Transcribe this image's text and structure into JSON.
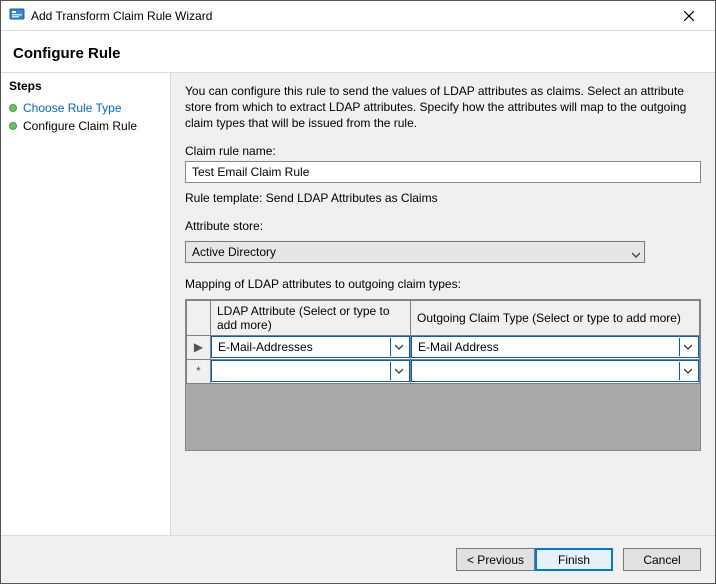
{
  "window": {
    "title": "Add Transform Claim Rule Wizard"
  },
  "header": {
    "title": "Configure Rule"
  },
  "steps": {
    "title": "Steps",
    "items": [
      {
        "label": "Choose Rule Type",
        "link": true
      },
      {
        "label": "Configure Claim Rule",
        "link": false
      }
    ]
  },
  "description": "You can configure this rule to send the values of LDAP attributes as claims. Select an attribute store from which to extract LDAP attributes. Specify how the attributes will map to the outgoing claim types that will be issued from the rule.",
  "form": {
    "claimRuleNameLabel": "Claim rule name:",
    "claimRuleName": "Test Email Claim Rule",
    "ruleTemplatePrefix": "Rule template: ",
    "ruleTemplate": "Send LDAP Attributes as Claims",
    "attributeStoreLabel": "Attribute store:",
    "attributeStore": "Active Directory",
    "mappingLabel": "Mapping of LDAP attributes to outgoing claim types:"
  },
  "grid": {
    "col1Header": "LDAP Attribute (Select or type to add more)",
    "col2Header": "Outgoing Claim Type (Select or type to add more)",
    "rows": [
      {
        "marker": "▶",
        "ldap": "E-Mail-Addresses",
        "claim": "E-Mail Address"
      },
      {
        "marker": "*",
        "ldap": "",
        "claim": ""
      }
    ]
  },
  "footer": {
    "previous": "< Previous",
    "finish": "Finish",
    "cancel": "Cancel"
  }
}
